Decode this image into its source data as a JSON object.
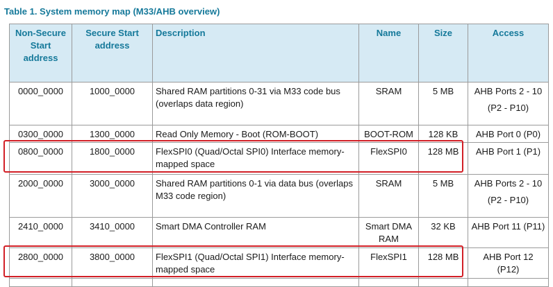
{
  "caption": "Table 1.  System memory map (M33/AHB overview)",
  "headers": {
    "nonsecure": "Non-Secure Start address",
    "secure": "Secure Start address",
    "description": "Description",
    "name": "Name",
    "size": "Size",
    "access": "Access"
  },
  "rows": [
    {
      "nonsecure": "0000_0000",
      "secure": "1000_0000",
      "description": "Shared RAM partitions 0-31 via M33 code bus (overlaps data region)",
      "name": "SRAM",
      "size": "5 MB",
      "access": "AHB Ports 2 - 10",
      "access_sub": "(P2 - P10)"
    },
    {
      "nonsecure": "0300_0000",
      "secure": "1300_0000",
      "description": "Read Only Memory - Boot (ROM-BOOT)",
      "name": "BOOT-ROM",
      "size": "128 KB",
      "access": "AHB Port 0 (P0)"
    },
    {
      "nonsecure": "0800_0000",
      "secure": "1800_0000",
      "description": "FlexSPI0 (Quad/Octal SPI0) Interface memory-mapped space",
      "name": "FlexSPI0",
      "size": "128 MB",
      "access": "AHB Port 1 (P1)"
    },
    {
      "nonsecure": "2000_0000",
      "secure": "3000_0000",
      "description": "Shared RAM partitions 0-1 via data bus (overlaps M33 code region)",
      "name": "SRAM",
      "size": "5 MB",
      "access": "AHB Ports 2 - 10",
      "access_sub": "(P2 - P10)"
    },
    {
      "nonsecure": "2410_0000",
      "secure": "3410_0000",
      "description": "Smart DMA Controller RAM",
      "name": "Smart DMA RAM",
      "size": "32 KB",
      "access": "AHB Port 11 (P11)"
    },
    {
      "nonsecure": "2800_0000",
      "secure": "3800_0000",
      "description": "FlexSPI1 (Quad/Octal SPI1) Interface memory-mapped space",
      "name": "FlexSPI1",
      "size": "128 MB",
      "access": "AHB Port 12 (P12)"
    }
  ],
  "highlight_color": "#d21f26",
  "header_bg": "#d6eaf4",
  "accent": "#15799a"
}
